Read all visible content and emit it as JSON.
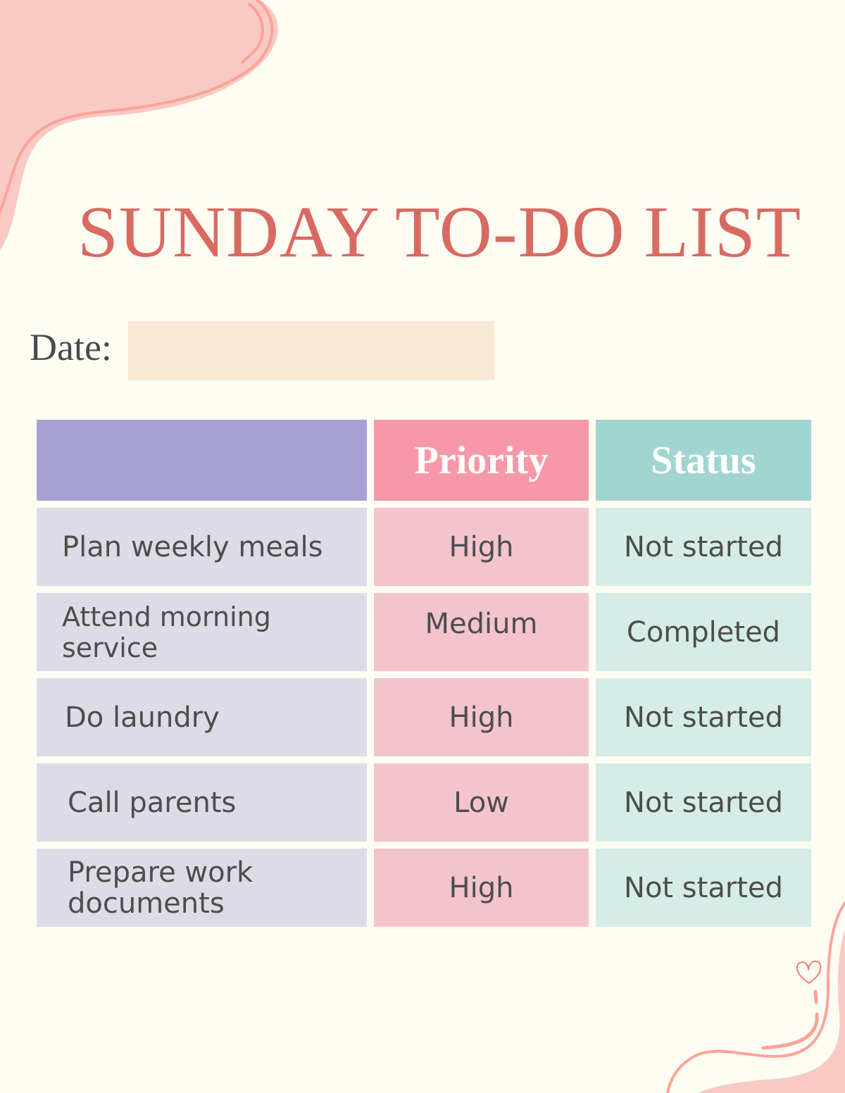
{
  "title": "SUNDAY TO-DO LIST",
  "date": {
    "label": "Date:",
    "value": ""
  },
  "table": {
    "headers": [
      "",
      "Priority",
      "Status"
    ],
    "rows": [
      {
        "task": "Plan weekly meals",
        "priority": "High",
        "status": "Not started"
      },
      {
        "task": "Attend morning service",
        "priority": "Medium",
        "status": "Completed"
      },
      {
        "task": "Do laundry",
        "priority": "High",
        "status": "Not started"
      },
      {
        "task": "Call parents",
        "priority": "Low",
        "status": "Not started"
      },
      {
        "task": "Prepare work documents",
        "priority": "High",
        "status": "Not started"
      }
    ]
  },
  "colors": {
    "background": "#fefdf4",
    "title": "#d96a61",
    "task_header": "#a7a0d4",
    "priority_header": "#f698a7",
    "status_header": "#a1d5cf",
    "task_cell": "#dddce6",
    "priority_cell": "#f4c4cd",
    "status_cell": "#d5ede6",
    "decoration": "#f8cac3",
    "decoration_line": "#fba398"
  }
}
